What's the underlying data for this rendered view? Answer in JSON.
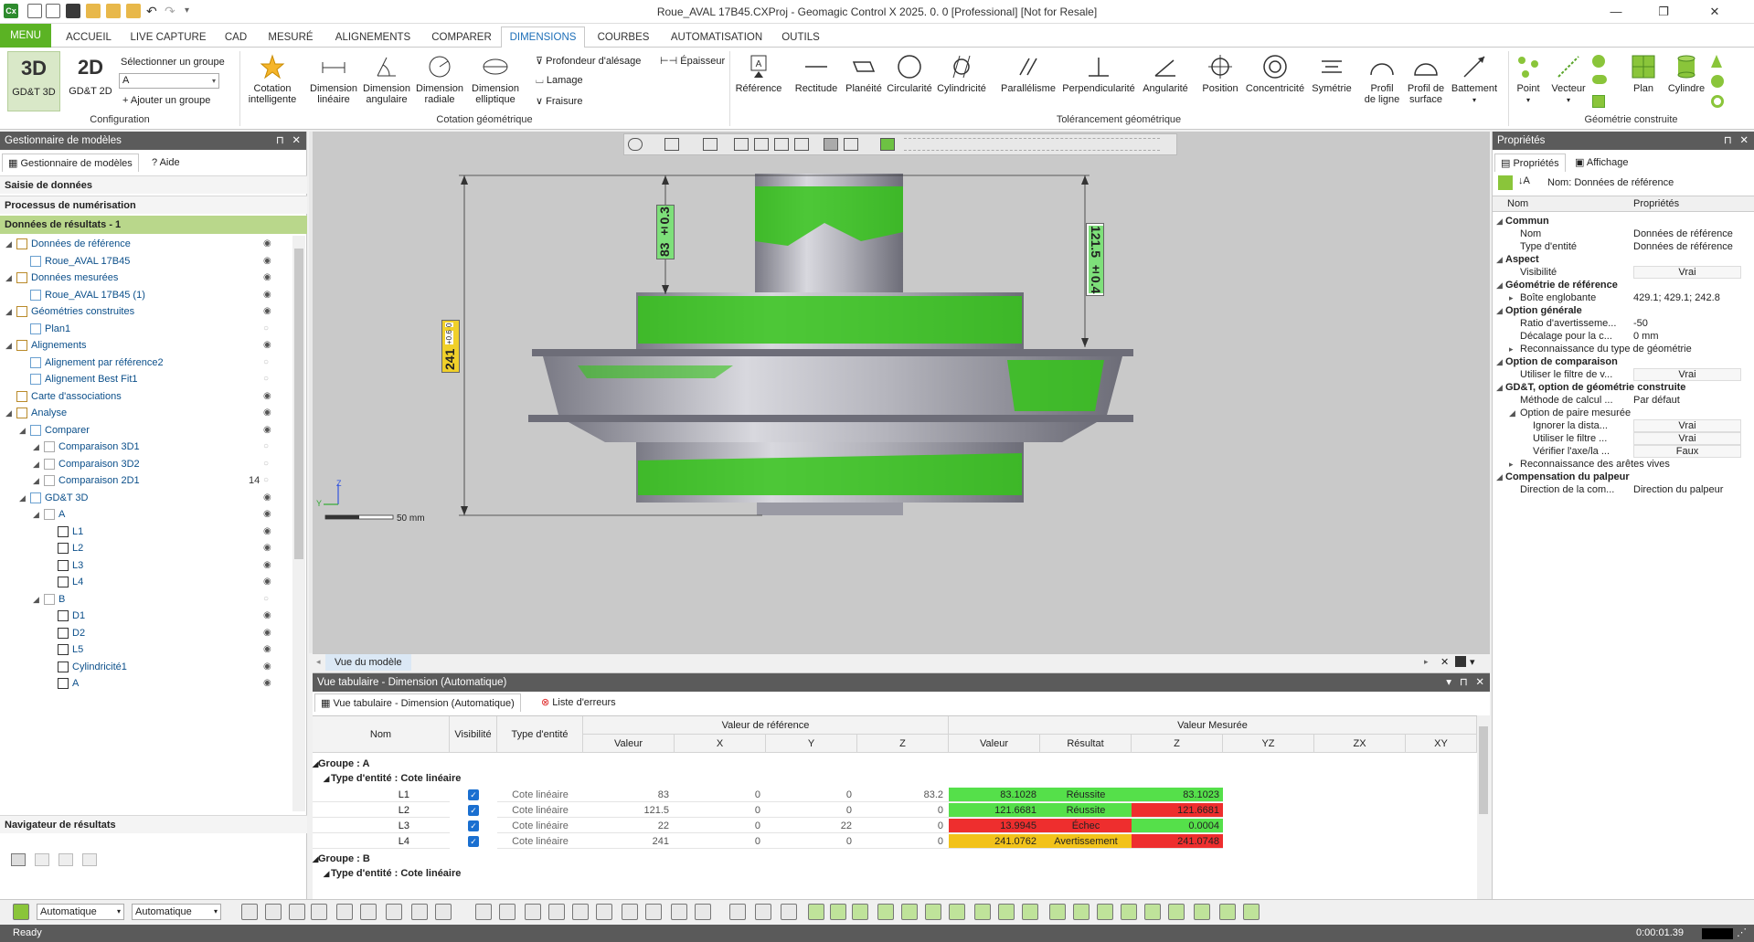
{
  "titlebar": {
    "title": "Roue_AVAL  17B45.CXProj - Geomagic Control X 2025. 0. 0 [Professional] [Not for Resale]",
    "app_icon": "Cx"
  },
  "menubar": {
    "tabs": [
      "MENU",
      "ACCUEIL",
      "LIVE CAPTURE",
      "CAD",
      "MESURÉ",
      "ALIGNEMENTS",
      "COMPARER",
      "DIMENSIONS",
      "COURBES",
      "AUTOMATISATION",
      "OUTILS"
    ],
    "active": "DIMENSIONS"
  },
  "ribbon": {
    "config": {
      "gdt3d_big": "3D",
      "gdt3d_label": "GD&T 3D",
      "gdt2d_big": "2D",
      "gdt2d_label": "GD&T 2D",
      "select_group_label": "Sélectionner un groupe",
      "group_value": "A",
      "add_group": "Ajouter un groupe",
      "group_title": "Configuration"
    },
    "cotation": {
      "buttons": [
        {
          "l1": "Cotation",
          "l2": "intelligente"
        },
        {
          "l1": "Dimension",
          "l2": "linéaire"
        },
        {
          "l1": "Dimension",
          "l2": "angulaire"
        },
        {
          "l1": "Dimension",
          "l2": "radiale"
        },
        {
          "l1": "Dimension",
          "l2": "elliptique"
        }
      ],
      "small": [
        "Profondeur d'alésage",
        "Lamage",
        "Fraisure",
        "Épaisseur"
      ],
      "group_title": "Cotation géométrique"
    },
    "tolerancement": {
      "buttons": [
        "Référence",
        "Rectitude",
        "Planéité",
        "Circularité",
        "Cylindricité",
        "Parallélisme",
        "Perpendicularité",
        "Angularité",
        "Position",
        "Concentricité",
        "Symétrie"
      ],
      "profil_ligne": {
        "l1": "Profil",
        "l2": "de ligne"
      },
      "profil_surface": {
        "l1": "Profil de",
        "l2": "surface"
      },
      "battement": "Battement",
      "group_title": "Tolérancement géométrique"
    },
    "construite": {
      "buttons": [
        "Point",
        "Vecteur",
        "Plan",
        "Cylindre"
      ],
      "group_title": "Géométrie construite"
    }
  },
  "left_panel": {
    "title": "Gestionnaire de modèles",
    "tabs": [
      "Gestionnaire de modèles",
      "Aide"
    ],
    "sections": [
      "Saisie de données",
      "Processus de numérisation",
      "Données de résultats - 1"
    ],
    "tree": [
      {
        "label": "Données de référence",
        "level": 0,
        "eye": "on"
      },
      {
        "label": "Roue_AVAL  17B45",
        "level": 1,
        "eye": "on"
      },
      {
        "label": "Données mesurées",
        "level": 0,
        "eye": "on"
      },
      {
        "label": "Roue_AVAL  17B45 (1)",
        "level": 1,
        "eye": "on"
      },
      {
        "label": "Géométries construites",
        "level": 0,
        "eye": "on"
      },
      {
        "label": "Plan1",
        "level": 1,
        "eye": "off"
      },
      {
        "label": "Alignements",
        "level": 0,
        "eye": "on"
      },
      {
        "label": "Alignement par référence2",
        "level": 1,
        "eye": "off"
      },
      {
        "label": "Alignement Best Fit1",
        "level": 1,
        "eye": "off"
      },
      {
        "label": "Carte d'associations",
        "level": 0,
        "eye": "on"
      },
      {
        "label": "Analyse",
        "level": 0,
        "eye": "on"
      },
      {
        "label": "Comparer",
        "level": 1,
        "eye": "on"
      },
      {
        "label": "Comparaison 3D1",
        "level": 2,
        "eye": "off"
      },
      {
        "label": "Comparaison 3D2",
        "level": 2,
        "eye": "off"
      },
      {
        "label": "Comparaison 2D1",
        "level": 2,
        "eye": "off",
        "count": "14"
      },
      {
        "label": "GD&T 3D",
        "level": 1,
        "eye": "on"
      },
      {
        "label": "A",
        "level": 2,
        "eye": "on"
      },
      {
        "label": "L1",
        "level": 3,
        "eye": "on"
      },
      {
        "label": "L2",
        "level": 3,
        "eye": "on"
      },
      {
        "label": "L3",
        "level": 3,
        "eye": "on"
      },
      {
        "label": "L4",
        "level": 3,
        "eye": "on"
      },
      {
        "label": "B",
        "level": 2,
        "eye": "off"
      },
      {
        "label": "D1",
        "level": 3,
        "eye": "on"
      },
      {
        "label": "D2",
        "level": 3,
        "eye": "on"
      },
      {
        "label": "L5",
        "level": 3,
        "eye": "on"
      },
      {
        "label": "Cylindricité1",
        "level": 3,
        "eye": "on"
      },
      {
        "label": "A",
        "level": 3,
        "eye": "on"
      }
    ],
    "navigator": "Navigateur de résultats"
  },
  "viewport": {
    "dims": {
      "d83": "83 ±0.3",
      "d121": "121.5 ±0.4",
      "d241": "241",
      "d241_tol_up": "+0.6",
      "d241_tol_low": "0"
    },
    "scale": "50 mm",
    "tab": "Vue du modèle",
    "axis_y": "Y",
    "axis_z": "Z"
  },
  "table_panel": {
    "title": "Vue tabulaire - Dimension (Automatique)",
    "tabs": [
      "Vue tabulaire - Dimension (Automatique)",
      "Liste d'erreurs"
    ],
    "headers": {
      "nom": "Nom",
      "vis": "Visibilité",
      "type": "Type d'entité",
      "ref": "Valeur de référence",
      "mes": "Valeur Mesurée"
    },
    "subheaders": [
      "Valeur",
      "X",
      "Y",
      "Z",
      "Valeur",
      "Résultat",
      "Z",
      "YZ",
      "ZX",
      "XY"
    ],
    "groupA": "Groupe : A",
    "typeA": "Type d'entité : Cote linéaire",
    "groupB": "Groupe : B",
    "typeB": "Type d'entité : Cote linéaire",
    "rows": [
      {
        "nom": "L1",
        "type": "Cote linéaire",
        "val": "83",
        "x": "0",
        "y": "0",
        "z": "83.2",
        "mval": "83.1028",
        "res": "Réussite",
        "mz": "83.1023",
        "cval": "#55e04a",
        "cres": "#55e04a",
        "cz": "#55e04a"
      },
      {
        "nom": "L2",
        "type": "Cote linéaire",
        "val": "121.5",
        "x": "0",
        "y": "0",
        "z": "0",
        "mval": "121.6681",
        "res": "Réussite",
        "mz": "121.6681",
        "cval": "#55e04a",
        "cres": "#55e04a",
        "cz": "#ee2e2e"
      },
      {
        "nom": "L3",
        "type": "Cote linéaire",
        "val": "22",
        "x": "0",
        "y": "22",
        "z": "0",
        "mval": "13.9945",
        "res": "Échec",
        "mz": "0.0004",
        "cval": "#ee2e2e",
        "cres": "#ee2e2e",
        "cz": "#55e04a"
      },
      {
        "nom": "L4",
        "type": "Cote linéaire",
        "val": "241",
        "x": "0",
        "y": "0",
        "z": "0",
        "mval": "241.0762",
        "res": "Avertissement",
        "mz": "241.0748",
        "cval": "#f2c21a",
        "cres": "#f2c21a",
        "cz": "#ee2e2e"
      }
    ]
  },
  "right_panel": {
    "title": "Propriétés",
    "tabs": [
      "Propriétés",
      "Affichage"
    ],
    "nom_label": "Nom: Données de référence",
    "col_nom": "Nom",
    "col_prop": "Propriétés",
    "rows": [
      {
        "k": "Commun",
        "v": "",
        "type": "cat",
        "lvl": 0
      },
      {
        "k": "Nom",
        "v": "Données de référence",
        "type": "row",
        "lvl": 1
      },
      {
        "k": "Type d'entité",
        "v": "Données de référence",
        "type": "row",
        "lvl": 1
      },
      {
        "k": "Aspect",
        "v": "",
        "type": "cat",
        "lvl": 0
      },
      {
        "k": "Visibilité",
        "v": "Vrai",
        "type": "box",
        "lvl": 1
      },
      {
        "k": "Géométrie de référence",
        "v": "",
        "type": "cat",
        "lvl": 0
      },
      {
        "k": "Boîte englobante",
        "v": "429.1; 429.1; 242.8",
        "type": "sub",
        "lvl": 1
      },
      {
        "k": "Option générale",
        "v": "",
        "type": "cat",
        "lvl": 0
      },
      {
        "k": "Ratio d'avertisseme...",
        "v": "-50",
        "type": "row",
        "lvl": 1
      },
      {
        "k": "Décalage pour la c...",
        "v": "0 mm",
        "type": "row",
        "lvl": 1
      },
      {
        "k": "Reconnaissance du type de géométrie",
        "v": "",
        "type": "sub",
        "lvl": 1
      },
      {
        "k": "Option de comparaison",
        "v": "",
        "type": "cat",
        "lvl": 0
      },
      {
        "k": "Utiliser le filtre de v...",
        "v": "Vrai",
        "type": "box",
        "lvl": 1
      },
      {
        "k": "GD&T, option de géométrie construite",
        "v": "",
        "type": "cat",
        "lvl": 0
      },
      {
        "k": "Méthode de calcul ...",
        "v": "Par défaut",
        "type": "row",
        "lvl": 1
      },
      {
        "k": "Option de paire mesurée",
        "v": "",
        "type": "subopen",
        "lvl": 1
      },
      {
        "k": "Ignorer la dista...",
        "v": "Vrai",
        "type": "box",
        "lvl": 2
      },
      {
        "k": "Utiliser le filtre ...",
        "v": "Vrai",
        "type": "box",
        "lvl": 2
      },
      {
        "k": "Vérifier l'axe/la ...",
        "v": "Faux",
        "type": "box",
        "lvl": 2
      },
      {
        "k": "Reconnaissance des arêtes vives",
        "v": "",
        "type": "sub",
        "lvl": 1
      },
      {
        "k": "Compensation du palpeur",
        "v": "",
        "type": "cat",
        "lvl": 0
      },
      {
        "k": "Direction de la com...",
        "v": "Direction du palpeur",
        "type": "row",
        "lvl": 1
      }
    ]
  },
  "bottom_toolbar": {
    "combo1": "Automatique",
    "combo2": "Automatique"
  },
  "statusbar": {
    "left": "Ready",
    "time": "0:00:01.39"
  }
}
